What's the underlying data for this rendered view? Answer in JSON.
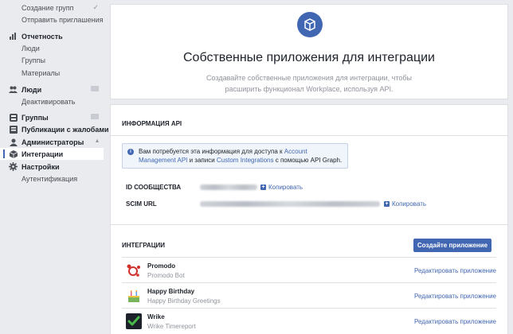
{
  "sidebar": {
    "items": [
      {
        "label": "Создание групп",
        "type": "sub",
        "right": "check"
      },
      {
        "label": "Отправить приглашения",
        "type": "sub"
      },
      {
        "label": "Отчетность",
        "type": "head",
        "icon": "bar-chart-icon"
      },
      {
        "label": "Люди",
        "type": "sub"
      },
      {
        "label": "Группы",
        "type": "sub"
      },
      {
        "label": "Материалы",
        "type": "sub"
      },
      {
        "label": "Люди",
        "type": "head",
        "icon": "people-icon",
        "right": "grey-badge"
      },
      {
        "label": "Деактивировать",
        "type": "sub"
      },
      {
        "label": "Группы",
        "type": "head",
        "icon": "groups-icon",
        "right": "grey-badge"
      },
      {
        "label": "Публикации с жалобами",
        "type": "head",
        "icon": "reports-icon"
      },
      {
        "label": "Администраторы",
        "type": "head",
        "icon": "admin-icon",
        "right": "up-arrow"
      },
      {
        "label": "Интеграции",
        "type": "head",
        "icon": "cube-icon",
        "active": true
      },
      {
        "label": "Настройки",
        "type": "head",
        "icon": "gear-icon"
      },
      {
        "label": "Аутентификация",
        "type": "sub"
      }
    ]
  },
  "header": {
    "title": "Собственные приложения для интеграции",
    "subtitle": "Создавайте собственные приложения для интеграции, чтобы расширить функционал Workplace, используя API."
  },
  "api_info": {
    "section_title": "ИНФОРМАЦИЯ API",
    "notice_prefix": "Вам потребуется эта информация для доступа к ",
    "notice_link1": "Account Management API",
    "notice_mid": " и записи ",
    "notice_link2": "Custom Integrations",
    "notice_suffix": " с помощью API Graph.",
    "community_id_label": "ID СООБЩЕСТВА",
    "scim_url_label": "SCIM URL",
    "copy_label": "Копировать"
  },
  "integrations": {
    "section_title": "ИНТЕГРАЦИИ",
    "create_button": "Создайте приложение",
    "edit_label": "Редактировать приложение",
    "apps": [
      {
        "name": "Promodo",
        "description": "Promodo Bot",
        "icon": "promodo-icon"
      },
      {
        "name": "Happy Birthday",
        "description": "Happy Birthday Greetings",
        "icon": "birthday-icon"
      },
      {
        "name": "Wrike",
        "description": "Wrike Timereport",
        "icon": "wrike-icon"
      }
    ]
  },
  "colors": {
    "accent": "#4267b2",
    "background": "#e9ebee",
    "muted": "#90949c"
  }
}
